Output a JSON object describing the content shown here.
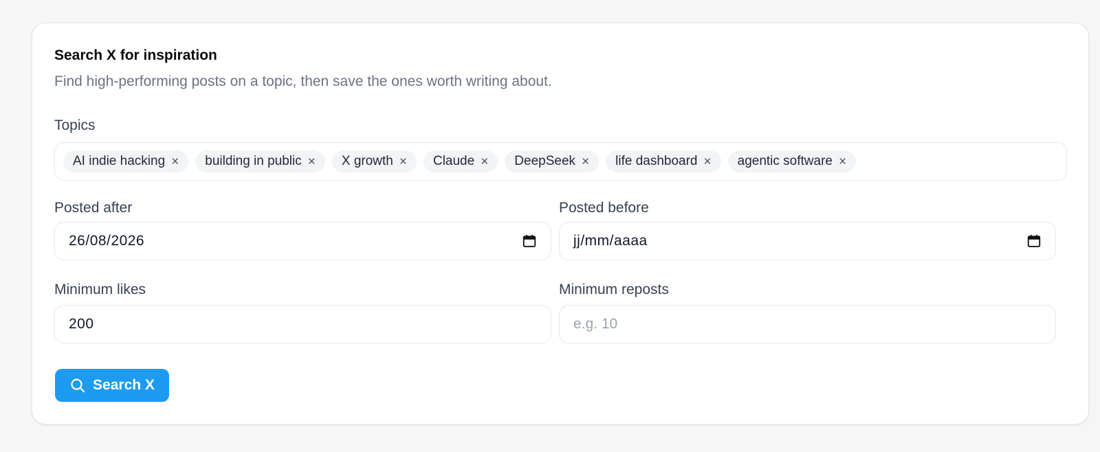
{
  "card": {
    "title": "Search X for inspiration",
    "subtitle": "Find high-performing posts on a topic, then save the ones worth writing about."
  },
  "topics": {
    "label": "Topics",
    "tags": [
      {
        "label": "AI indie hacking",
        "remove": "×"
      },
      {
        "label": "building in public",
        "remove": "×"
      },
      {
        "label": "X growth",
        "remove": "×"
      },
      {
        "label": "Claude",
        "remove": "×"
      },
      {
        "label": "DeepSeek",
        "remove": "×"
      },
      {
        "label": "life dashboard",
        "remove": "×"
      },
      {
        "label": "agentic software",
        "remove": "×"
      }
    ]
  },
  "posted_after": {
    "label": "Posted after",
    "value": "26/08/2026",
    "icon": "calendar-icon"
  },
  "posted_before": {
    "label": "Posted before",
    "value": "jj/mm/aaaa",
    "icon": "calendar-icon"
  },
  "min_likes": {
    "label": "Minimum likes",
    "value": "200"
  },
  "min_reposts": {
    "label": "Minimum reposts",
    "value": "",
    "placeholder": "e.g. 10"
  },
  "search_button": {
    "label": "Search X",
    "icon": "search-icon",
    "color": "#1d9bf0"
  }
}
